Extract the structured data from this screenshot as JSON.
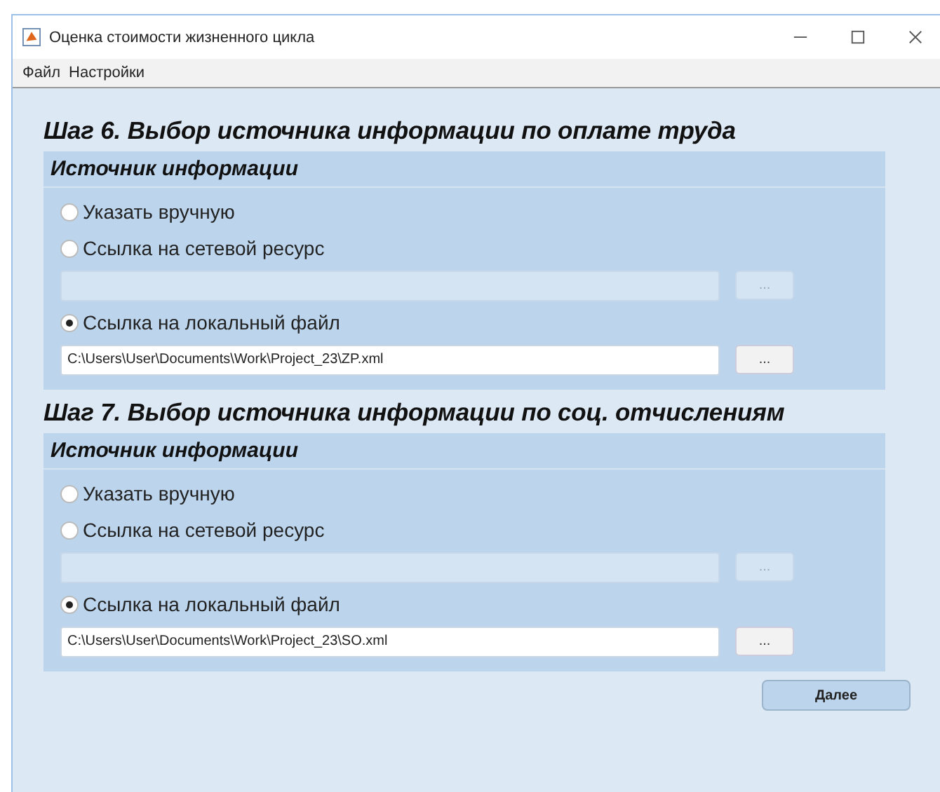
{
  "window": {
    "title": "Оценка стоимости жизненного цикла"
  },
  "menu": [
    "Файл",
    "Настройки"
  ],
  "steps": [
    {
      "title": "Шаг 6. Выбор источника информации по оплате труда",
      "panel_title": "Источник информации",
      "rows": [
        {
          "kind": "radio",
          "label": "Указать вручную",
          "selected": false
        },
        {
          "kind": "radio",
          "label": "Ссылка на сетевой ресурс",
          "selected": false
        },
        {
          "kind": "path",
          "disabled": true,
          "button": "..."
        },
        {
          "kind": "radio",
          "label": "Ссылка на локальный файл",
          "selected": true
        },
        {
          "kind": "path",
          "disabled": false,
          "value": "C:\\Users\\User\\Documents\\Work\\Project_23\\ZP.xml",
          "button": "..."
        }
      ]
    },
    {
      "title": "Шаг 7. Выбор источника информации по соц. отчислениям",
      "panel_title": "Источник информации",
      "rows": [
        {
          "kind": "radio",
          "label": "Указать вручную",
          "selected": false
        },
        {
          "kind": "radio",
          "label": "Ссылка на сетевой ресурс",
          "selected": false
        },
        {
          "kind": "path",
          "disabled": true,
          "button": "..."
        },
        {
          "kind": "radio",
          "label": "Ссылка на локальный файл",
          "selected": true
        },
        {
          "kind": "path",
          "disabled": false,
          "value": "C:\\Users\\User\\Documents\\Work\\Project_23\\SO.xml",
          "button": "..."
        }
      ]
    }
  ],
  "next_button": "Далее"
}
